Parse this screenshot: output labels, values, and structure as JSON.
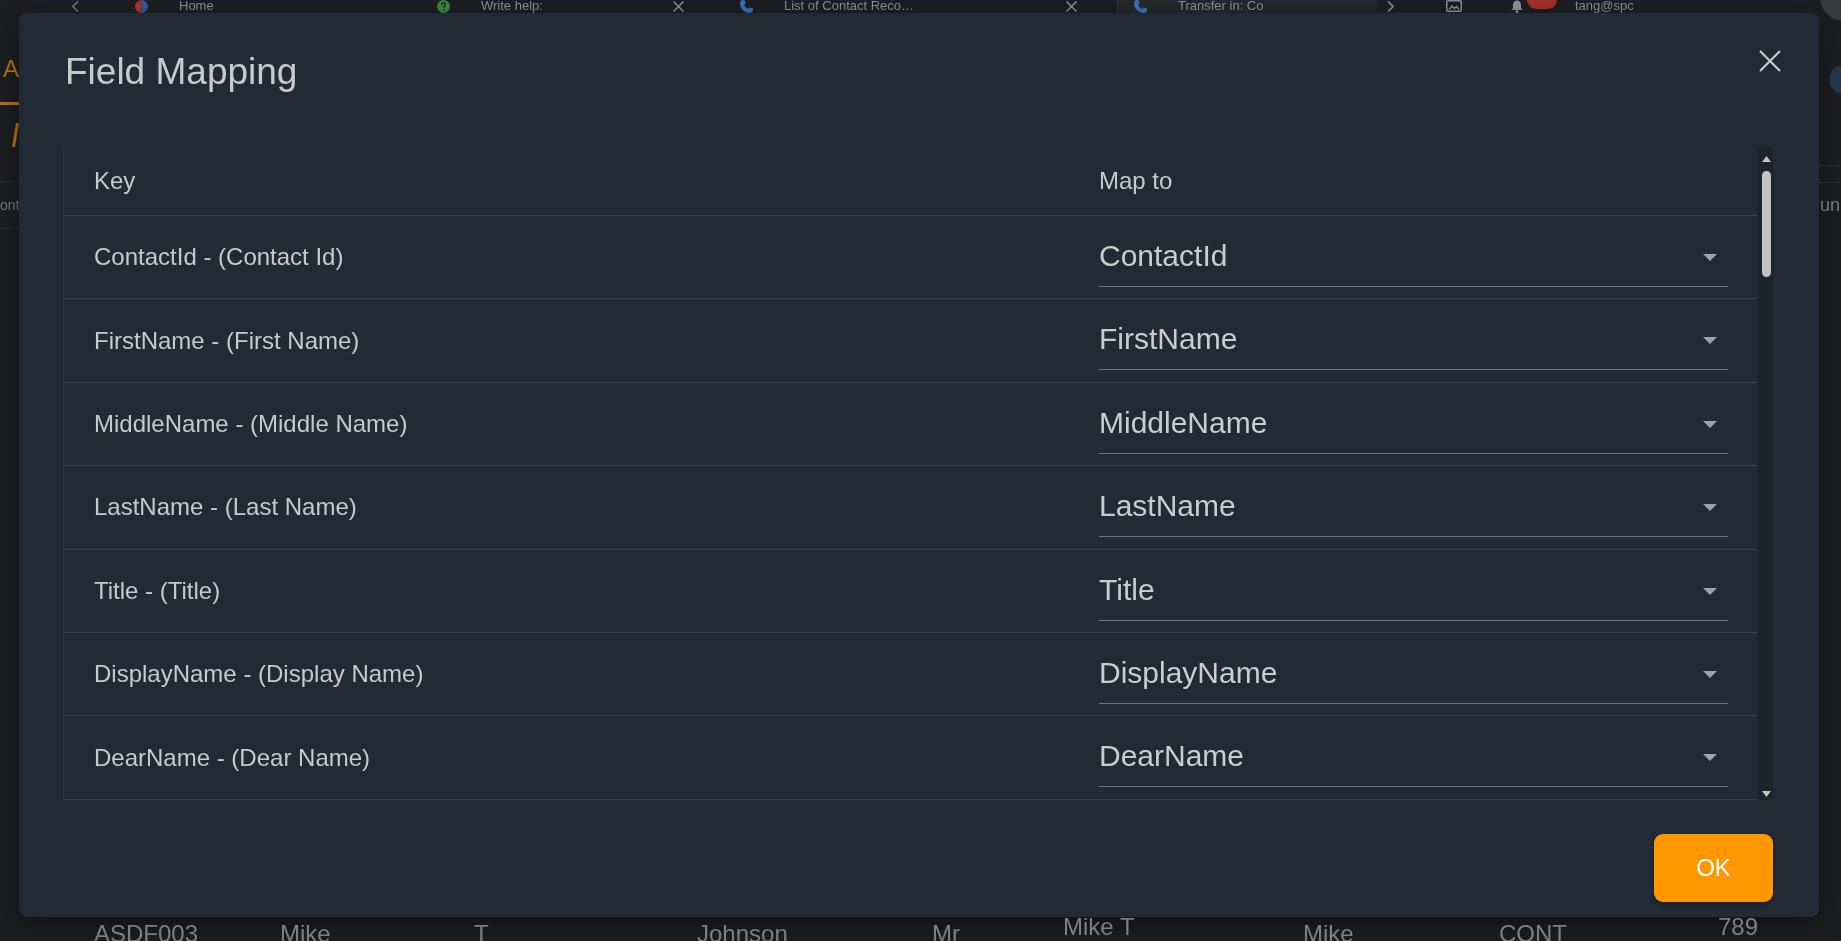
{
  "browser_bar": {
    "tabs": [
      {
        "label": "Home",
        "closable": false,
        "selected": false
      },
      {
        "label": "Write help:",
        "closable": true,
        "selected": false
      },
      {
        "label": "List of Contact Reco…",
        "closable": true,
        "selected": false
      },
      {
        "label": "Transfer in: Co",
        "closable": false,
        "selected": true
      }
    ],
    "notification_badge": true,
    "user": "tang@spc"
  },
  "page_tabs": [
    {
      "label": "A",
      "selected": true
    }
  ],
  "left_column_header": "ont",
  "right_column_header": "un",
  "dialog": {
    "title": "Field Mapping",
    "columns": [
      "Key",
      "Map to"
    ],
    "rows": [
      {
        "key": "ContactId - (Contact Id)",
        "value": "ContactId"
      },
      {
        "key": "FirstName - (First Name)",
        "value": "FirstName"
      },
      {
        "key": "MiddleName - (Middle Name)",
        "value": "MiddleName"
      },
      {
        "key": "LastName - (Last Name)",
        "value": "LastName"
      },
      {
        "key": "Title - (Title)",
        "value": "Title"
      },
      {
        "key": "DisplayName - (Display Name)",
        "value": "DisplayName"
      },
      {
        "key": "DearName - (Dear Name)",
        "value": "DearName"
      }
    ],
    "ok_button": "OK"
  },
  "background_row": [
    {
      "text": "ASDF003",
      "kind": "single"
    },
    {
      "text": "Mike",
      "kind": "single"
    },
    {
      "text": "T",
      "kind": "single"
    },
    {
      "text": "Johnson",
      "kind": "single"
    },
    {
      "text": "Mr",
      "kind": "single"
    },
    {
      "text": "Mike T",
      "kind": "two_line"
    },
    {
      "text": "Mike",
      "kind": "single"
    },
    {
      "text": "CONT",
      "kind": "single"
    },
    {
      "text": "789",
      "kind": "two_line"
    }
  ]
}
